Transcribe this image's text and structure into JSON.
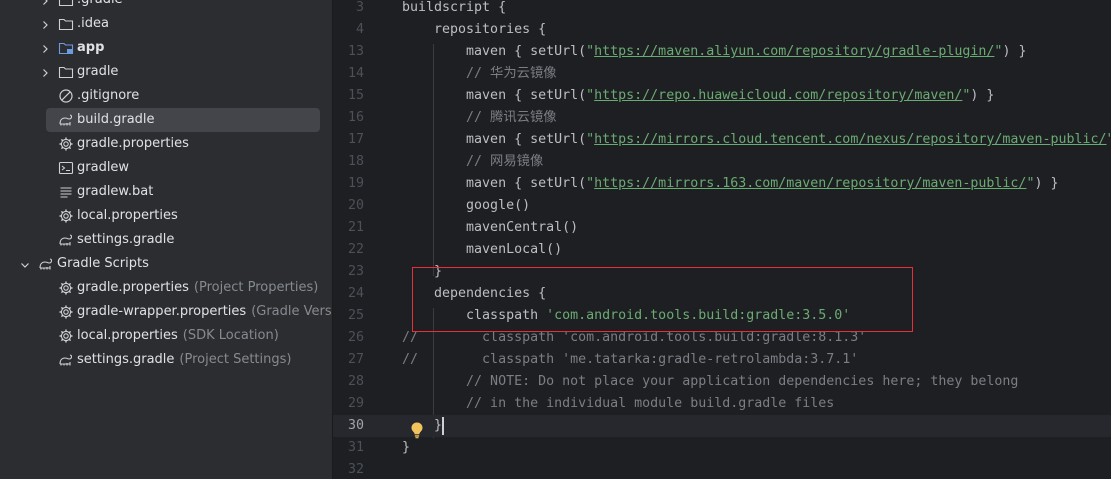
{
  "project_tree": {
    "items": [
      {
        "label": ".gradle",
        "hint": "",
        "icon": "folder-icon",
        "chevron": "right",
        "indent": 1,
        "bold": false,
        "selected": false
      },
      {
        "label": ".idea",
        "hint": "",
        "icon": "folder-icon",
        "chevron": "right",
        "indent": 1,
        "bold": false,
        "selected": false
      },
      {
        "label": "app",
        "hint": "",
        "icon": "module-folder-icon",
        "chevron": "right",
        "indent": 1,
        "bold": true,
        "selected": false
      },
      {
        "label": "gradle",
        "hint": "",
        "icon": "folder-icon",
        "chevron": "right",
        "indent": 1,
        "bold": false,
        "selected": false
      },
      {
        "label": ".gitignore",
        "hint": "",
        "icon": "ignore-file-icon",
        "chevron": "",
        "indent": 1,
        "bold": false,
        "selected": false
      },
      {
        "label": "build.gradle",
        "hint": "",
        "icon": "gradle-elephant-icon",
        "chevron": "",
        "indent": 1,
        "bold": false,
        "selected": true
      },
      {
        "label": "gradle.properties",
        "hint": "",
        "icon": "settings-gear-icon",
        "chevron": "",
        "indent": 1,
        "bold": false,
        "selected": false
      },
      {
        "label": "gradlew",
        "hint": "",
        "icon": "terminal-icon",
        "chevron": "",
        "indent": 1,
        "bold": false,
        "selected": false
      },
      {
        "label": "gradlew.bat",
        "hint": "",
        "icon": "text-file-icon",
        "chevron": "",
        "indent": 1,
        "bold": false,
        "selected": false
      },
      {
        "label": "local.properties",
        "hint": "",
        "icon": "settings-gear-icon",
        "chevron": "",
        "indent": 1,
        "bold": false,
        "selected": false
      },
      {
        "label": "settings.gradle",
        "hint": "",
        "icon": "gradle-elephant-icon",
        "chevron": "",
        "indent": 1,
        "bold": false,
        "selected": false
      },
      {
        "label": "Gradle Scripts",
        "hint": "",
        "icon": "gradle-elephant-icon",
        "chevron": "down",
        "indent": 0,
        "bold": false,
        "selected": false
      },
      {
        "label": "gradle.properties",
        "hint": "(Project Properties)",
        "icon": "settings-gear-icon",
        "chevron": "",
        "indent": 1,
        "bold": false,
        "selected": false
      },
      {
        "label": "gradle-wrapper.properties",
        "hint": "(Gradle Version)",
        "icon": "settings-gear-icon",
        "chevron": "",
        "indent": 1,
        "bold": false,
        "selected": false
      },
      {
        "label": "local.properties",
        "hint": "(SDK Location)",
        "icon": "settings-gear-icon",
        "chevron": "",
        "indent": 1,
        "bold": false,
        "selected": false
      },
      {
        "label": "settings.gradle",
        "hint": "(Project Settings)",
        "icon": "gradle-elephant-icon",
        "chevron": "",
        "indent": 1,
        "bold": false,
        "selected": false
      }
    ]
  },
  "editor": {
    "current_line": "30",
    "lines": [
      {
        "num": "3",
        "segments": [
          {
            "t": "buildscript {",
            "c": "kw"
          }
        ]
      },
      {
        "num": "4",
        "segments": [
          {
            "t": "    repositories {",
            "c": "kw"
          }
        ]
      },
      {
        "num": "13",
        "segments": [
          {
            "t": "        maven { setUrl(",
            "c": "kw"
          },
          {
            "t": "\"",
            "c": "str"
          },
          {
            "t": "https://maven.aliyun.com/repository/gradle-plugin/",
            "c": "url"
          },
          {
            "t": "\"",
            "c": "str"
          },
          {
            "t": ") }",
            "c": "kw"
          }
        ]
      },
      {
        "num": "14",
        "segments": [
          {
            "t": "        // 华为云镜像",
            "c": "cmt"
          }
        ]
      },
      {
        "num": "15",
        "segments": [
          {
            "t": "        maven { setUrl(",
            "c": "kw"
          },
          {
            "t": "\"",
            "c": "str"
          },
          {
            "t": "https://repo.huaweicloud.com/repository/maven/",
            "c": "url"
          },
          {
            "t": "\"",
            "c": "str"
          },
          {
            "t": ") }",
            "c": "kw"
          }
        ]
      },
      {
        "num": "16",
        "segments": [
          {
            "t": "        // 腾讯云镜像",
            "c": "cmt"
          }
        ]
      },
      {
        "num": "17",
        "segments": [
          {
            "t": "        maven { setUrl(",
            "c": "kw"
          },
          {
            "t": "\"",
            "c": "str"
          },
          {
            "t": "https://mirrors.cloud.tencent.com/nexus/repository/maven-public/",
            "c": "url"
          },
          {
            "t": "\"",
            "c": "str"
          }
        ]
      },
      {
        "num": "18",
        "segments": [
          {
            "t": "        // 网易镜像",
            "c": "cmt"
          }
        ]
      },
      {
        "num": "19",
        "segments": [
          {
            "t": "        maven { setUrl(",
            "c": "kw"
          },
          {
            "t": "\"",
            "c": "str"
          },
          {
            "t": "https://mirrors.163.com/maven/repository/maven-public/",
            "c": "url"
          },
          {
            "t": "\"",
            "c": "str"
          },
          {
            "t": ") }",
            "c": "kw"
          }
        ]
      },
      {
        "num": "20",
        "segments": [
          {
            "t": "        google()",
            "c": "kw"
          }
        ]
      },
      {
        "num": "21",
        "segments": [
          {
            "t": "        mavenCentral()",
            "c": "kw"
          }
        ]
      },
      {
        "num": "22",
        "segments": [
          {
            "t": "        mavenLocal()",
            "c": "kw"
          }
        ]
      },
      {
        "num": "23",
        "segments": [
          {
            "t": "    }",
            "c": "kw"
          }
        ]
      },
      {
        "num": "24",
        "segments": [
          {
            "t": "    dependencies {",
            "c": "kw"
          }
        ]
      },
      {
        "num": "25",
        "segments": [
          {
            "t": "        classpath ",
            "c": "kw"
          },
          {
            "t": "'com.android.tools.build:gradle:3.5.0'",
            "c": "str"
          }
        ]
      },
      {
        "num": "26",
        "segments": [
          {
            "t": "//        classpath 'com.android.tools.build:gradle:8.1.3'",
            "c": "cmt"
          }
        ]
      },
      {
        "num": "27",
        "segments": [
          {
            "t": "//        classpath 'me.tatarka:gradle-retrolambda:3.7.1'",
            "c": "cmt"
          }
        ]
      },
      {
        "num": "28",
        "segments": [
          {
            "t": "        // NOTE: Do not place your application dependencies here; they belong",
            "c": "cmt"
          }
        ]
      },
      {
        "num": "29",
        "segments": [
          {
            "t": "        // in the individual module build.gradle files",
            "c": "cmt"
          }
        ]
      },
      {
        "num": "30",
        "segments": [
          {
            "t": "    }",
            "c": "kw"
          }
        ]
      },
      {
        "num": "31",
        "segments": [
          {
            "t": "}",
            "c": "kw"
          }
        ]
      },
      {
        "num": "32",
        "segments": []
      }
    ]
  },
  "colors": {
    "sidebar_bg": "#2b2d30",
    "editor_bg": "#1e1f22",
    "selection_bg": "#43454a",
    "string": "#6aab73",
    "comment": "#7a7e85",
    "highlight_box": "#e5303a",
    "bulb": "#f2c55c"
  }
}
